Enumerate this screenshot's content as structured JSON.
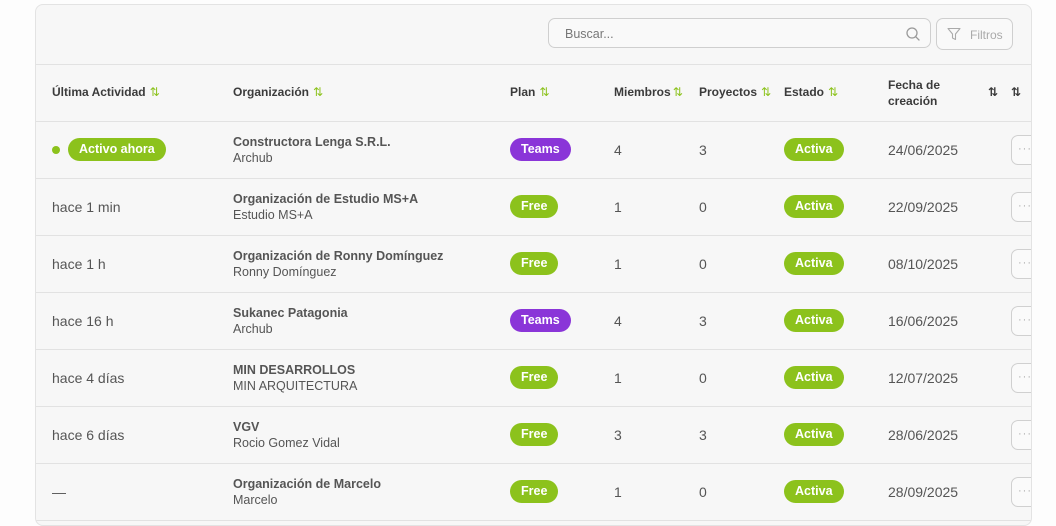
{
  "toolbar": {
    "search_placeholder": "Buscar...",
    "filters_label": "Filtros"
  },
  "columns": {
    "activity": "Última Actividad",
    "organization": "Organización",
    "plan": "Plan",
    "members": "Miembros",
    "projects": "Proyectos",
    "status": "Estado",
    "created_line1": "Fecha de",
    "created_line2": "creación",
    "sort_icon": "⇅"
  },
  "colors": {
    "accent_green": "#8cc21c",
    "teams_purple": "#8a35d8"
  },
  "rows": [
    {
      "activity": "Activo ahora",
      "live": true,
      "org": "Constructora Lenga S.R.L.",
      "sub": "Archub",
      "plan": "Teams",
      "members": "4",
      "projects": "3",
      "status": "Activa",
      "created": "24/06/2025"
    },
    {
      "activity": "hace 1 min",
      "live": false,
      "org": "Organización de Estudio MS+A",
      "sub": "Estudio MS+A",
      "plan": "Free",
      "members": "1",
      "projects": "0",
      "status": "Activa",
      "created": "22/09/2025"
    },
    {
      "activity": "hace 1 h",
      "live": false,
      "org": "Organización de Ronny Domínguez",
      "sub": "Ronny Domínguez",
      "plan": "Free",
      "members": "1",
      "projects": "0",
      "status": "Activa",
      "created": "08/10/2025"
    },
    {
      "activity": "hace 16 h",
      "live": false,
      "org": "Sukanec Patagonia",
      "sub": "Archub",
      "plan": "Teams",
      "members": "4",
      "projects": "3",
      "status": "Activa",
      "created": "16/06/2025"
    },
    {
      "activity": "hace 4 días",
      "live": false,
      "org": "MIN DESARROLLOS",
      "sub": "MIN ARQUITECTURA",
      "plan": "Free",
      "members": "1",
      "projects": "0",
      "status": "Activa",
      "created": "12/07/2025"
    },
    {
      "activity": "hace 6 días",
      "live": false,
      "org": "VGV",
      "sub": "Rocio Gomez Vidal",
      "plan": "Free",
      "members": "3",
      "projects": "3",
      "status": "Activa",
      "created": "28/06/2025"
    },
    {
      "activity": "—",
      "live": false,
      "org": "Organización de Marcelo",
      "sub": "Marcelo",
      "plan": "Free",
      "members": "1",
      "projects": "0",
      "status": "Activa",
      "created": "28/09/2025"
    }
  ],
  "row_actions_label": "···"
}
